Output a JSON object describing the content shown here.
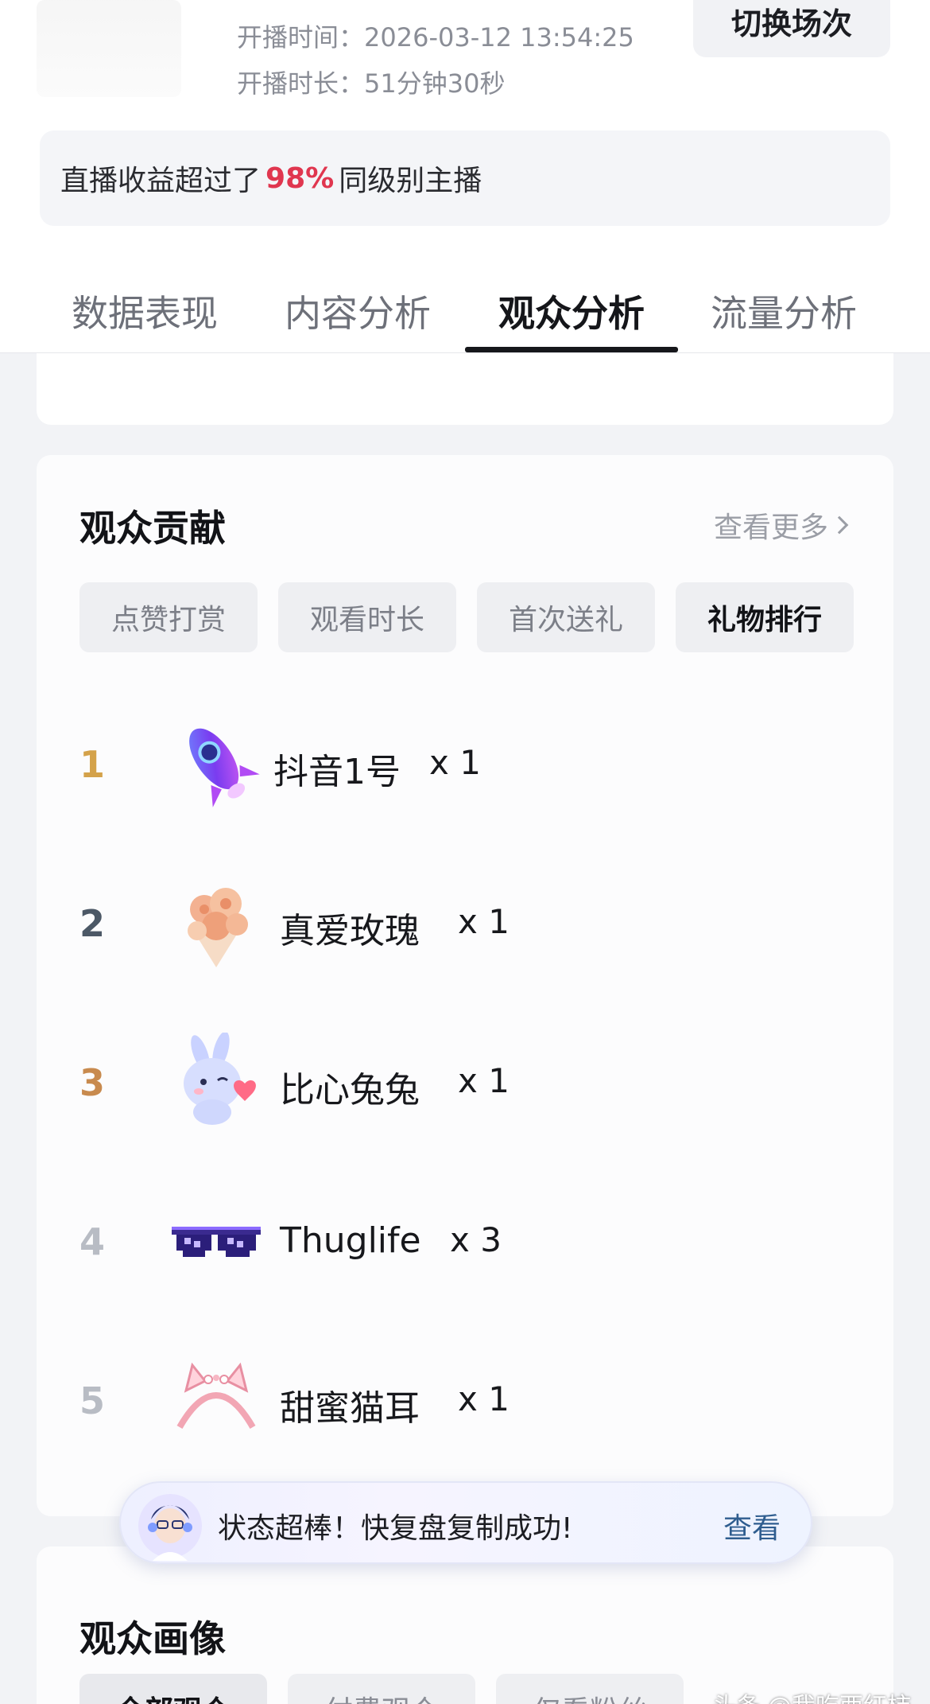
{
  "header": {
    "start_time": "开播时间：2026-03-12 13:54:25",
    "duration": "开播时长：51分钟30秒",
    "switch_button": "切换场次"
  },
  "revenue": {
    "prefix": "直播收益超过了",
    "percent": "98%",
    "suffix": "同级别主播",
    "accent_color": "#e0364f"
  },
  "tabs": [
    {
      "label": "数据表现",
      "active": false
    },
    {
      "label": "内容分析",
      "active": false
    },
    {
      "label": "观众分析",
      "active": true
    },
    {
      "label": "流量分析",
      "active": false
    }
  ],
  "contribution": {
    "title": "观众贡献",
    "see_more": "查看更多",
    "filters": [
      {
        "label": "点赞打赏",
        "active": false
      },
      {
        "label": "观看时长",
        "active": false
      },
      {
        "label": "首次送礼",
        "active": false
      },
      {
        "label": "礼物排行",
        "active": true
      }
    ],
    "ranking": [
      {
        "rank": "1",
        "name": "抖音1号",
        "count": "x 1",
        "icon": "rocket-gift-icon",
        "rank_color": "#d4a24a"
      },
      {
        "rank": "2",
        "name": "真爱玫瑰",
        "count": "x 1",
        "icon": "rose-bouquet-gift-icon",
        "rank_color": "#4c5866"
      },
      {
        "rank": "3",
        "name": "比心兔兔",
        "count": "x 1",
        "icon": "heart-bunny-gift-icon",
        "rank_color": "#c88a4e"
      },
      {
        "rank": "4",
        "name": "Thuglife",
        "count": "x 3",
        "icon": "pixel-sunglasses-gift-icon",
        "rank_color": "#b8bcc4"
      },
      {
        "rank": "5",
        "name": "甜蜜猫耳",
        "count": "x 1",
        "icon": "cat-ear-headband-gift-icon",
        "rank_color": "#b8bcc4"
      }
    ]
  },
  "toast": {
    "message": "状态超棒！快复盘复制成功!",
    "action": "查看"
  },
  "portrait": {
    "title": "观众画像",
    "filters": [
      {
        "label": "全部观众",
        "active": true
      },
      {
        "label": "付费观众",
        "active": false
      },
      {
        "label": "仅看粉丝",
        "active": false
      }
    ]
  },
  "watermark": "头条 @我吃西红柿"
}
